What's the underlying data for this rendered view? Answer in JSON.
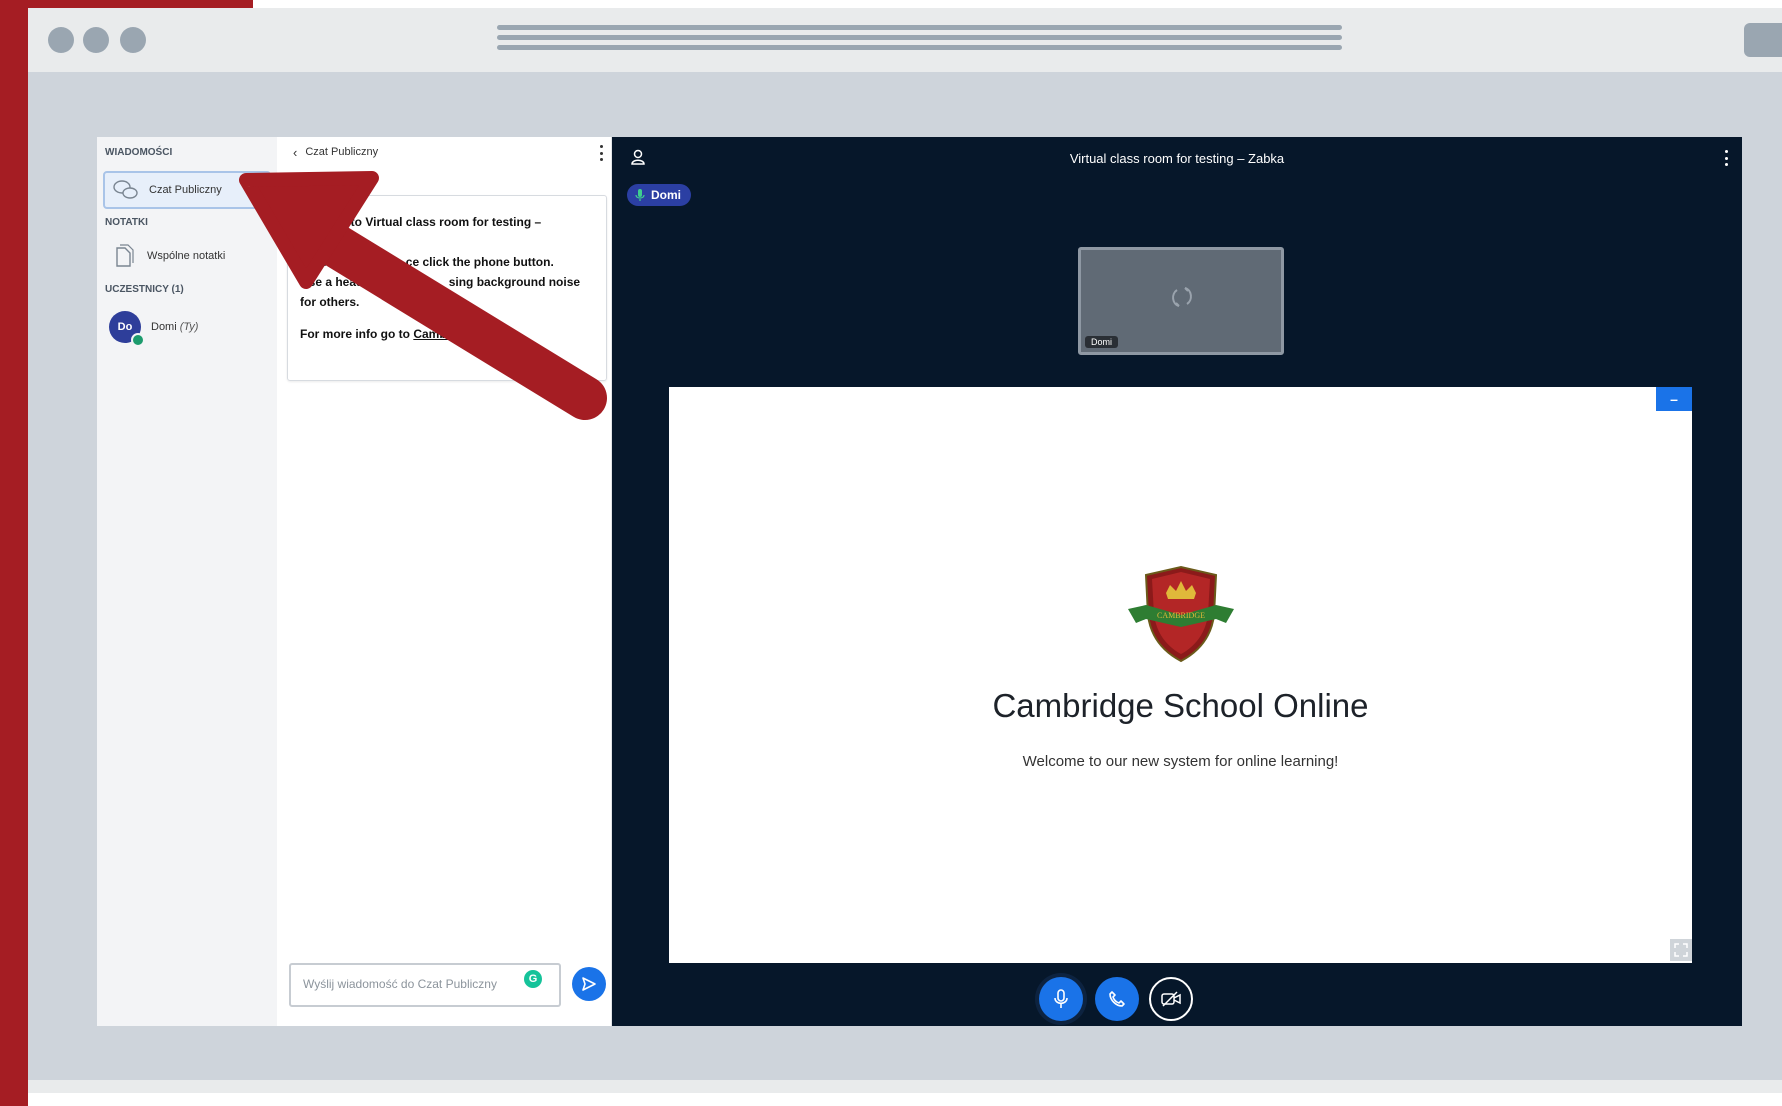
{
  "sidebar": {
    "messages_title": "WIADOMOŚCI",
    "public_chat": "Czat Publiczny",
    "notes_title": "NOTATKI",
    "shared_notes": "Wspólne notatki",
    "participants_title": "UCZESTNICY (1)",
    "user_initials": "Do",
    "user_name": "Domi",
    "user_you": "(Ty)"
  },
  "chat": {
    "header": "Czat Publiczny",
    "welcome_prefix": "me to Virtual class room for testing –",
    "join_line1_start": "To join t",
    "join_line1_end": "ce click the phone button.",
    "join_line2_start": "Use a headse",
    "join_line2_end": "sing background noise",
    "join_line3": "for others.",
    "info_text": "For more info go to ",
    "info_link": "Cambridg",
    "input_placeholder": "Wyślij wiadomość do Czat Publiczny",
    "grammarly_letter": "G"
  },
  "main": {
    "title": "Virtual class room for testing – Zabka",
    "talker": "Domi",
    "video_label": "Domi"
  },
  "slide": {
    "crest_text": "CAMBRIDGE",
    "title": "Cambridge School Online",
    "subtitle": "Welcome to our new system for online learning!",
    "minimize": "–"
  },
  "colors": {
    "accent_red": "#a51d23",
    "brand_blue": "#1a73e8",
    "main_bg": "#06172a"
  }
}
